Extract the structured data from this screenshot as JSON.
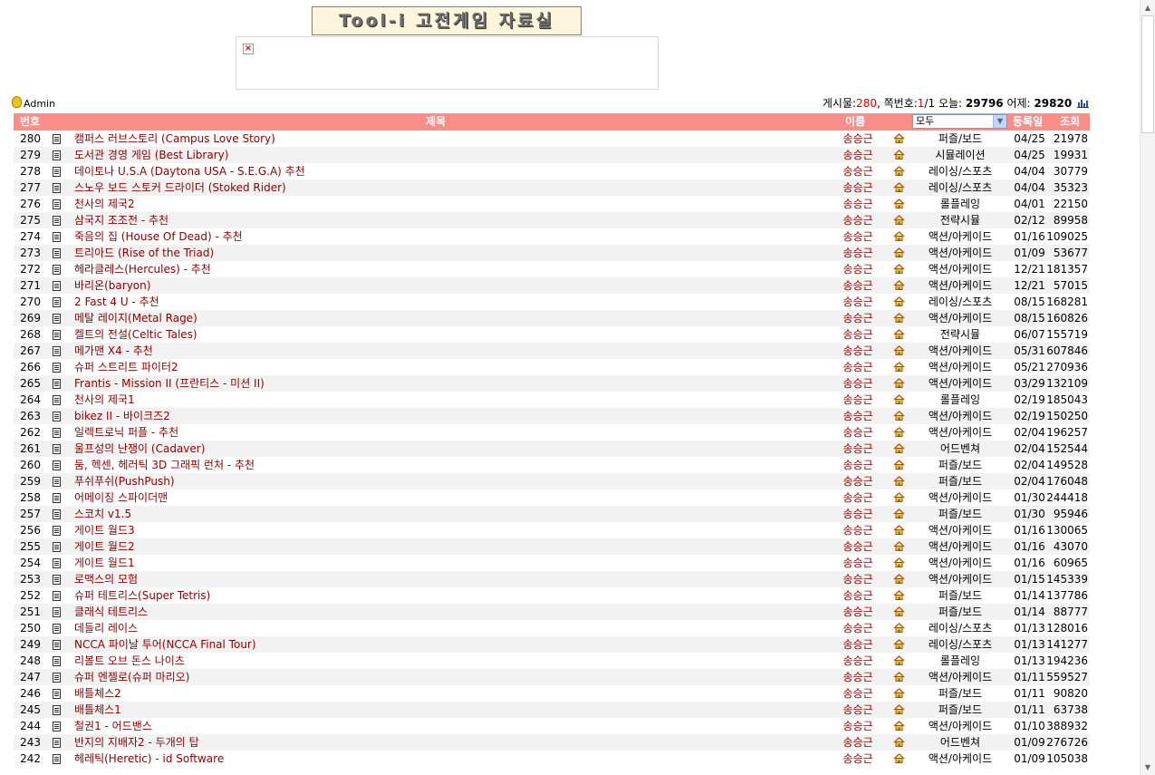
{
  "banner": {
    "title": "Tool-i 고전게임 자료실"
  },
  "admin_label": "Admin",
  "stats": {
    "posts_label": "게시물:",
    "posts_value": "280",
    "page_label": "쪽번호:",
    "page_current": "1",
    "page_total": "/1",
    "today_label": "오늘:",
    "today_value": "29796",
    "yesterday_label": "어제:",
    "yesterday_value": "29820"
  },
  "header": {
    "num": "번호",
    "title": "제목",
    "name": "이름",
    "category_selected": "모두",
    "date": "등록일",
    "hits": "조회"
  },
  "rows": [
    {
      "num": "280",
      "title": "캠퍼스 러브스토리 (Campus Love Story)",
      "name": "송승근",
      "category": "퍼즐/보드",
      "date": "04/25",
      "hits": "21978"
    },
    {
      "num": "279",
      "title": "도서관 경영 게임 (Best Library)",
      "name": "송승근",
      "category": "시뮬레이션",
      "date": "04/25",
      "hits": "19931"
    },
    {
      "num": "278",
      "title": "데이토나 U.S.A (Daytona USA - S.E.G.A) 추천",
      "name": "송승근",
      "category": "레이싱/스포츠",
      "date": "04/04",
      "hits": "30779"
    },
    {
      "num": "277",
      "title": "스노우 보드 스토커 드라이더 (Stoked Rider)",
      "name": "송승근",
      "category": "레이싱/스포츠",
      "date": "04/04",
      "hits": "35323"
    },
    {
      "num": "276",
      "title": "천사의 제국2",
      "name": "송승근",
      "category": "롤플레잉",
      "date": "04/01",
      "hits": "22150"
    },
    {
      "num": "275",
      "title": "삼국지 조조전 - 추천",
      "name": "송승근",
      "category": "전략시뮬",
      "date": "02/12",
      "hits": "89958"
    },
    {
      "num": "274",
      "title": "죽음의 집 (House Of Dead) - 추천",
      "name": "송승근",
      "category": "액션/아케이드",
      "date": "01/16",
      "hits": "109025"
    },
    {
      "num": "273",
      "title": "트리아드 (Rise of the Triad)",
      "name": "송승근",
      "category": "액션/아케이드",
      "date": "01/09",
      "hits": "53677"
    },
    {
      "num": "272",
      "title": "헤라클레스(Hercules) - 추천",
      "name": "송승근",
      "category": "액션/아케이드",
      "date": "12/21",
      "hits": "181357"
    },
    {
      "num": "271",
      "title": "바리온(baryon)",
      "name": "송승근",
      "category": "액션/아케이드",
      "date": "12/21",
      "hits": "57015"
    },
    {
      "num": "270",
      "title": "2 Fast 4 U - 추천",
      "name": "송승근",
      "category": "레이싱/스포츠",
      "date": "08/15",
      "hits": "168281"
    },
    {
      "num": "269",
      "title": "메탈 레이지(Metal Rage)",
      "name": "송승근",
      "category": "액션/아케이드",
      "date": "08/15",
      "hits": "160826"
    },
    {
      "num": "268",
      "title": "켈트의 전설(Celtic Tales)",
      "name": "송승근",
      "category": "전략시뮬",
      "date": "06/07",
      "hits": "155719"
    },
    {
      "num": "267",
      "title": "메가맨 X4 - 추천",
      "name": "송승근",
      "category": "액션/아케이드",
      "date": "05/31",
      "hits": "607846"
    },
    {
      "num": "266",
      "title": "슈퍼 스트리트 파이터2",
      "name": "송승근",
      "category": "액션/아케이드",
      "date": "05/21",
      "hits": "270936"
    },
    {
      "num": "265",
      "title": "Frantis - Mission II (프란티스 - 미션 II)",
      "name": "송승근",
      "category": "액션/아케이드",
      "date": "03/29",
      "hits": "132109"
    },
    {
      "num": "264",
      "title": "천사의 제국1",
      "name": "송승근",
      "category": "롤플레잉",
      "date": "02/19",
      "hits": "185043"
    },
    {
      "num": "263",
      "title": "bikez II - 바이크즈2",
      "name": "송승근",
      "category": "액션/아케이드",
      "date": "02/19",
      "hits": "150250"
    },
    {
      "num": "262",
      "title": "일렉트로닉 퍼플 - 추천",
      "name": "송승근",
      "category": "액션/아케이드",
      "date": "02/04",
      "hits": "196257"
    },
    {
      "num": "261",
      "title": "울프성의 난쟁이 (Cadaver)",
      "name": "송승근",
      "category": "어드벤쳐",
      "date": "02/04",
      "hits": "152544"
    },
    {
      "num": "260",
      "title": "둠, 헥센, 헤러틱 3D 그래픽 런처 - 추천",
      "name": "송승근",
      "category": "퍼즐/보드",
      "date": "02/04",
      "hits": "149528"
    },
    {
      "num": "259",
      "title": "푸쉬푸쉬(PushPush)",
      "name": "송승근",
      "category": "퍼즐/보드",
      "date": "02/04",
      "hits": "176048"
    },
    {
      "num": "258",
      "title": "어메이징 스파이더맨",
      "name": "송승근",
      "category": "액션/아케이드",
      "date": "01/30",
      "hits": "244418"
    },
    {
      "num": "257",
      "title": "스코치 v1.5",
      "name": "송승근",
      "category": "퍼즐/보드",
      "date": "01/30",
      "hits": "95946"
    },
    {
      "num": "256",
      "title": "게이트 월드3",
      "name": "송승근",
      "category": "액션/아케이드",
      "date": "01/16",
      "hits": "130065"
    },
    {
      "num": "255",
      "title": "게이트 월드2",
      "name": "송승근",
      "category": "액션/아케이드",
      "date": "01/16",
      "hits": "43070"
    },
    {
      "num": "254",
      "title": "게이트 월드1",
      "name": "송승근",
      "category": "액션/아케이드",
      "date": "01/16",
      "hits": "60965"
    },
    {
      "num": "253",
      "title": "로맥스의 모험",
      "name": "송승근",
      "category": "액션/아케이드",
      "date": "01/15",
      "hits": "145339"
    },
    {
      "num": "252",
      "title": "슈퍼 테트리스(Super Tetris)",
      "name": "송승근",
      "category": "퍼즐/보드",
      "date": "01/14",
      "hits": "137786"
    },
    {
      "num": "251",
      "title": "클래식 테트리스",
      "name": "송승근",
      "category": "퍼즐/보드",
      "date": "01/14",
      "hits": "88777"
    },
    {
      "num": "250",
      "title": "데들리 레이스",
      "name": "송승근",
      "category": "레이싱/스포츠",
      "date": "01/13",
      "hits": "128016"
    },
    {
      "num": "249",
      "title": "NCCA 파이날 투어(NCCA Final Tour)",
      "name": "송승근",
      "category": "레이싱/스포츠",
      "date": "01/13",
      "hits": "141277"
    },
    {
      "num": "248",
      "title": "리볼트 오브 돈스 나이츠",
      "name": "송승근",
      "category": "롤플레잉",
      "date": "01/13",
      "hits": "194236"
    },
    {
      "num": "247",
      "title": "슈퍼 엔젤로(슈퍼 마리오)",
      "name": "송승근",
      "category": "액션/아케이드",
      "date": "01/11",
      "hits": "559527"
    },
    {
      "num": "246",
      "title": "배틀체스2",
      "name": "송승근",
      "category": "퍼즐/보드",
      "date": "01/11",
      "hits": "90820"
    },
    {
      "num": "245",
      "title": "배틀체스1",
      "name": "송승근",
      "category": "퍼즐/보드",
      "date": "01/11",
      "hits": "63738"
    },
    {
      "num": "244",
      "title": "철권1 - 어드밴스",
      "name": "송승근",
      "category": "액션/아케이드",
      "date": "01/10",
      "hits": "388932"
    },
    {
      "num": "243",
      "title": "반지의 지배자2 - 두개의 탑",
      "name": "송승근",
      "category": "어드벤쳐",
      "date": "01/09",
      "hits": "276726"
    },
    {
      "num": "242",
      "title": "헤레틱(Heretic) - id Software",
      "name": "송승근",
      "category": "액션/아케이드",
      "date": "01/09",
      "hits": "105038"
    }
  ]
}
